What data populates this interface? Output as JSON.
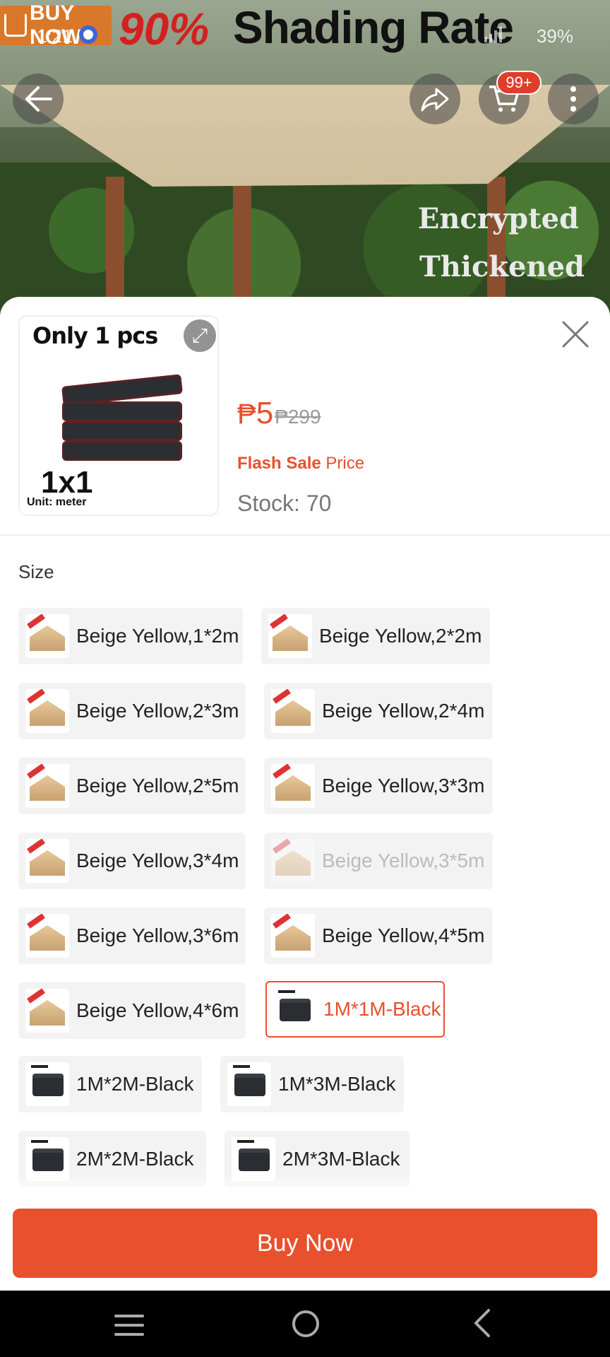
{
  "status_bar": {
    "time": "1:21",
    "battery": "39%"
  },
  "hero": {
    "banner_buy": "BUY NOW",
    "rate": "90%",
    "headline": "Shading Rate",
    "tag1": "Encrypted",
    "tag2": "Thickened"
  },
  "top_nav": {
    "cart_badge": "99+"
  },
  "product": {
    "thumb_title": "Only 1 pcs",
    "thumb_size": "1x1",
    "thumb_unit": "Unit: meter",
    "currency": "₱",
    "price": "5",
    "old_price": "₱299",
    "flash_label": "Flash Sale",
    "price_label": "Price",
    "stock": "Stock: 70"
  },
  "size_section": {
    "label": "Size",
    "options": [
      {
        "label": "Beige Yellow,1*2m",
        "type": "beige",
        "state": "normal"
      },
      {
        "label": "Beige Yellow,2*2m",
        "type": "beige",
        "state": "normal"
      },
      {
        "label": "Beige Yellow,2*3m",
        "type": "beige",
        "state": "normal"
      },
      {
        "label": "Beige Yellow,2*4m",
        "type": "beige",
        "state": "normal"
      },
      {
        "label": "Beige Yellow,2*5m",
        "type": "beige",
        "state": "normal"
      },
      {
        "label": "Beige Yellow,3*3m",
        "type": "beige",
        "state": "normal"
      },
      {
        "label": "Beige Yellow,3*4m",
        "type": "beige",
        "state": "normal"
      },
      {
        "label": "Beige Yellow,3*5m",
        "type": "beige",
        "state": "disabled"
      },
      {
        "label": "Beige Yellow,3*6m",
        "type": "beige",
        "state": "normal"
      },
      {
        "label": "Beige Yellow,4*5m",
        "type": "beige",
        "state": "normal"
      },
      {
        "label": "Beige Yellow,4*6m",
        "type": "beige",
        "state": "normal"
      },
      {
        "label": "1M*1M-Black",
        "type": "black",
        "state": "selected"
      },
      {
        "label": "1M*2M-Black",
        "type": "black",
        "state": "normal"
      },
      {
        "label": "1M*3M-Black",
        "type": "black",
        "state": "normal"
      },
      {
        "label": "2M*2M-Black",
        "type": "black",
        "state": "normal"
      },
      {
        "label": "2M*3M-Black",
        "type": "black",
        "state": "normal"
      }
    ]
  },
  "buy_button": {
    "label": "Buy Now"
  },
  "colors": {
    "accent": "#e8502e",
    "badge": "#e23c2a"
  }
}
